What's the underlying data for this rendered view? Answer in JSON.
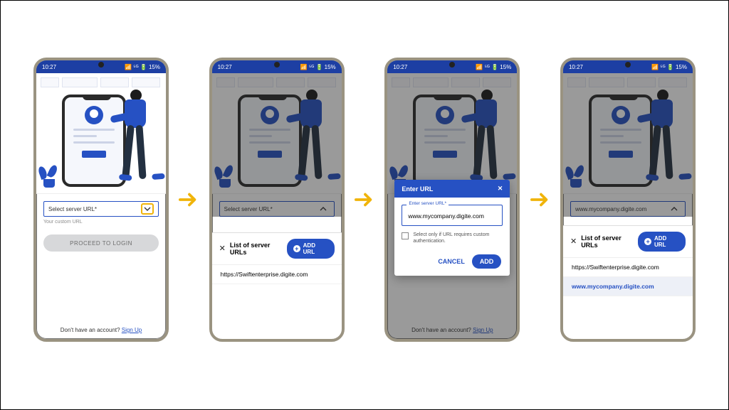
{
  "status_time": "10:27",
  "status_right": "📶 ⁵ᴳ 🔋 15%",
  "select_placeholder": "Select server URL*",
  "select_value": "www.mycompany.digite.com",
  "custom_url_hint": "Your custom URL",
  "proceed_label": "PROCEED TO LOGIN",
  "footer_prompt": "Don't have an account? ",
  "footer_link": "Sign Up",
  "sheet_title": "List of server URLs",
  "add_url_label": "ADD URL",
  "urls": {
    "item1": "https://Swiftenterprise.digite.com",
    "item2": "www.mycompany.digite.com"
  },
  "modal": {
    "title": "Enter URL",
    "field_label": "Enter server URL*",
    "field_value": "www.mycompany.digite.com",
    "checkbox_label": "Select only if URL requires custom authentication.",
    "cancel": "CANCEL",
    "add": "ADD"
  }
}
